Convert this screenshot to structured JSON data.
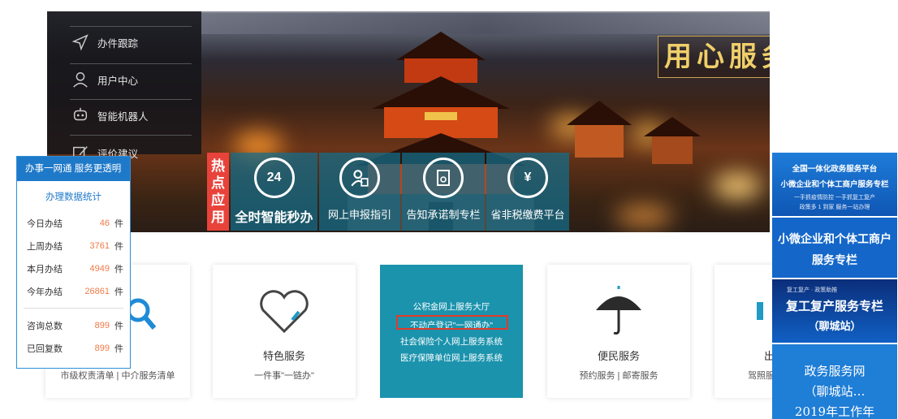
{
  "nav": {
    "items": [
      {
        "label": "办件跟踪",
        "icon": "send-icon"
      },
      {
        "label": "用户中心",
        "icon": "user-icon"
      },
      {
        "label": "智能机器人",
        "icon": "robot-icon"
      },
      {
        "label": "评价建议",
        "icon": "edit-icon"
      }
    ]
  },
  "banner": {
    "slogan": "用心服务"
  },
  "hot": {
    "tag": "热点应用",
    "tiles": [
      {
        "label": "全时智能秒办",
        "icon": "clock-24-icon",
        "icon_text": "24"
      },
      {
        "label": "网上申报指引",
        "icon": "user-guide-icon"
      },
      {
        "label": "告知承诺制专栏",
        "icon": "document-seal-icon"
      },
      {
        "label": "省非税缴费平台",
        "icon": "money-bag-icon",
        "icon_text": "¥"
      }
    ]
  },
  "stats": {
    "header": "办事一网通  服务更透明",
    "subtitle": "办理数据统计",
    "rows": [
      {
        "label": "今日办结",
        "value": "46",
        "unit": "件"
      },
      {
        "label": "上周办结",
        "value": "3761",
        "unit": "件"
      },
      {
        "label": "本月办结",
        "value": "4949",
        "unit": "件"
      },
      {
        "label": "今年办结",
        "value": "26861",
        "unit": "件"
      },
      {
        "label": "咨询总数",
        "value": "899",
        "unit": "件"
      },
      {
        "label": "已回复数",
        "value": "899",
        "unit": "件"
      }
    ]
  },
  "cards": {
    "c1": {
      "title": "",
      "sub": "市级权责清单 | 中介服务清单"
    },
    "c2": {
      "title": "特色服务",
      "sub": "一件事\"一链办\""
    },
    "c3": {
      "lines": [
        "公积金网上服务大厅",
        "不动产登记\"一网通办\"",
        "社会保险个人网上服务系统",
        "医疗保障单位网上服务系统"
      ]
    },
    "c4": {
      "title": "便民服务",
      "sub": "预约服务 | 邮寄服务"
    },
    "c5": {
      "title": "出",
      "sub": "驾照服"
    }
  },
  "ads": {
    "a1": {
      "line1": "全国一体化政务服务平台",
      "line2": "小微企业和个体工商户服务专栏",
      "line3": "一手抓疫情防控 一手抓复工复产",
      "line4": "政策多 1 到家 服务一站办理"
    },
    "a2": {
      "line1": "小微企业和个体工商户",
      "line2": "服务专栏"
    },
    "a3": {
      "small": "复工复产 · 政策助推",
      "line1": "复工复产服务专栏",
      "line2": "（聊城站）"
    },
    "a4": {
      "line1": "政务服务网",
      "line2": "（聊城站…",
      "line3": "2019年工作年"
    }
  },
  "colors": {
    "accent": "#1f79c9",
    "hot_red": "#e8433b",
    "teal": "#1b93ad",
    "number": "#f07a48"
  }
}
